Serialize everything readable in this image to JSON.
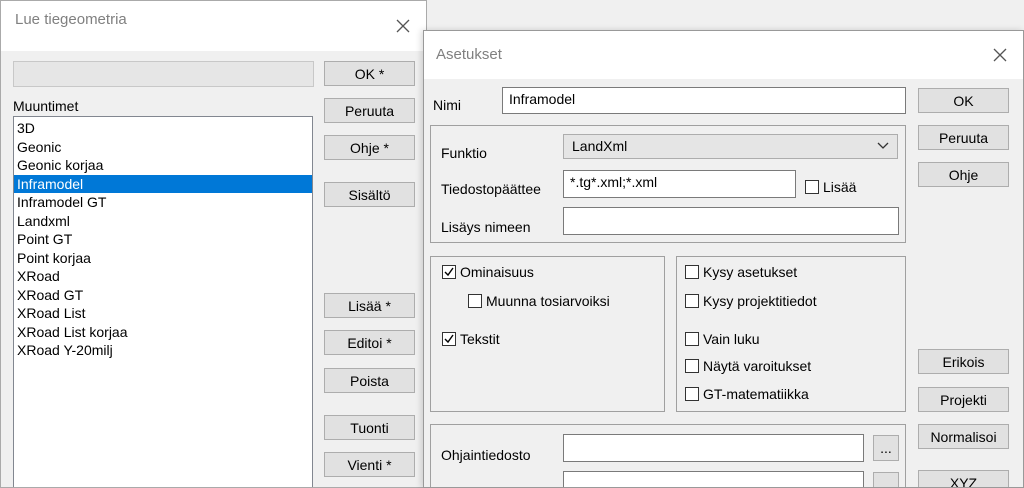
{
  "left_dialog": {
    "title": "Lue tiegeometria",
    "converters_label": "Muuntimet",
    "converters": [
      "3D",
      "Geonic",
      "Geonic korjaa",
      "Inframodel",
      "Inframodel GT",
      "Landxml",
      "Point GT",
      "Point korjaa",
      "XRoad",
      "XRoad GT",
      "XRoad List",
      "XRoad List korjaa",
      "XRoad Y-20milj"
    ],
    "selected_converter": "Inframodel",
    "buttons": {
      "ok": "OK *",
      "cancel": "Peruuta",
      "help": "Ohje *",
      "contents": "Sisältö",
      "add": "Lisää *",
      "edit": "Editoi *",
      "remove": "Poista",
      "import": "Tuonti",
      "export": "Vienti *"
    }
  },
  "settings_dialog": {
    "title": "Asetukset",
    "name_label": "Nimi",
    "name_value": "Inframodel",
    "function_label": "Funktio",
    "function_value": "LandXml",
    "extension_label": "Tiedostopäättee",
    "extension_value": "*.tg*.xml;*.xml",
    "add_checkbox_label": "Lisää",
    "add_checkbox_checked": false,
    "name_suffix_label": "Lisäys nimeen",
    "name_suffix_value": "",
    "options_left": [
      {
        "label": "Ominaisuus",
        "checked": true
      },
      {
        "label": "Muunna tosiarvoiksi",
        "checked": false
      },
      {
        "label": "Tekstit",
        "checked": true
      }
    ],
    "options_right": [
      {
        "label": "Kysy asetukset",
        "checked": false
      },
      {
        "label": "Kysy projektitiedot",
        "checked": false
      },
      {
        "label": "Vain luku",
        "checked": false
      },
      {
        "label": "Näytä varoitukset",
        "checked": false
      },
      {
        "label": "GT-matematiikka",
        "checked": false
      }
    ],
    "control_file_label": "Ohjaintiedosto",
    "control_file_value": "",
    "browse_label": "...",
    "buttons": {
      "ok": "OK",
      "cancel": "Peruuta",
      "help": "Ohje",
      "special": "Erikois",
      "project": "Projekti",
      "normalize": "Normalisoi",
      "xyz": "XYZ"
    }
  },
  "colors": {
    "selection": "#0078d7",
    "dialog_bg": "#f0f0f0",
    "title_text": "#808080"
  },
  "icons": {
    "close": "close-icon",
    "dropdown": "chevron-down-icon",
    "check": "check-icon"
  }
}
